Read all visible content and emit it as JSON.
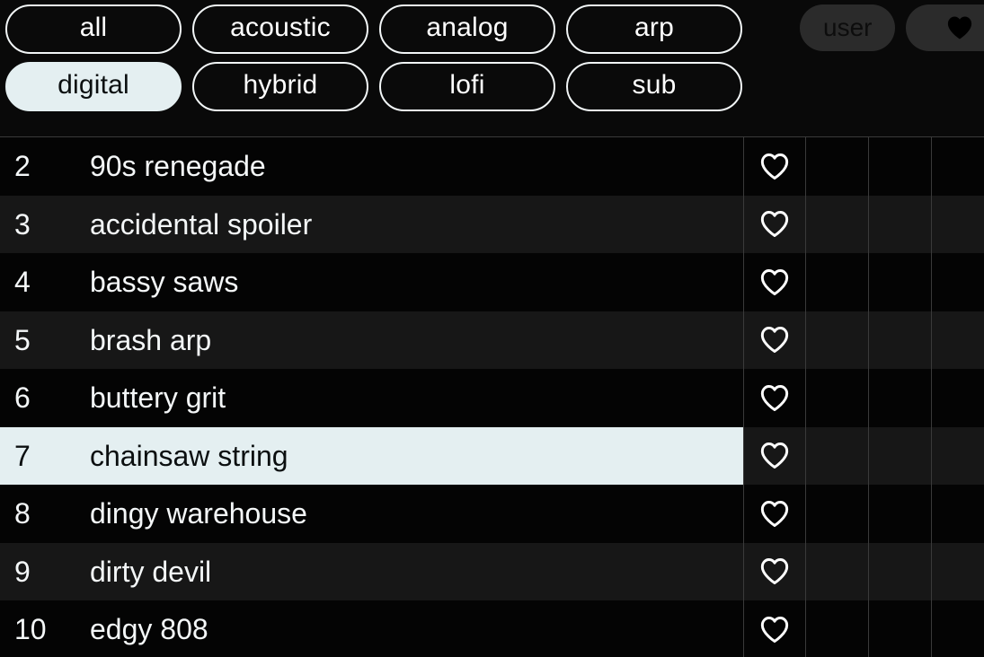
{
  "filters": {
    "chips": [
      {
        "label": "all",
        "selected": false
      },
      {
        "label": "acoustic",
        "selected": false
      },
      {
        "label": "analog",
        "selected": false
      },
      {
        "label": "arp",
        "selected": false
      },
      {
        "label": "digital",
        "selected": true
      },
      {
        "label": "hybrid",
        "selected": false
      },
      {
        "label": "lofi",
        "selected": false
      },
      {
        "label": "sub",
        "selected": false
      }
    ],
    "user_button_label": "user",
    "favorites_button_icon": "heart-filled-icon"
  },
  "colors": {
    "page_background": "#050505",
    "row_background": "#040404",
    "row_background_alt": "#171717",
    "selection": "#e4eff1",
    "chip_border": "#f2f6f7",
    "grid_line": "#3a3a3a",
    "pill_background": "#2b2b2b",
    "text": "#f4f7f8",
    "text_on_selection": "#0b0f10"
  },
  "list": {
    "favorite_icon": "heart-outline-icon",
    "column_divider_x": [
      827,
      896,
      966,
      1036
    ],
    "rows": [
      {
        "index": "2",
        "name": "90s renegade",
        "favorited": false,
        "selected": false
      },
      {
        "index": "3",
        "name": "accidental spoiler",
        "favorited": false,
        "selected": false
      },
      {
        "index": "4",
        "name": "bassy saws",
        "favorited": false,
        "selected": false
      },
      {
        "index": "5",
        "name": "brash arp",
        "favorited": false,
        "selected": false
      },
      {
        "index": "6",
        "name": "buttery grit",
        "favorited": false,
        "selected": false
      },
      {
        "index": "7",
        "name": "chainsaw string",
        "favorited": false,
        "selected": true
      },
      {
        "index": "8",
        "name": "dingy warehouse",
        "favorited": false,
        "selected": false
      },
      {
        "index": "9",
        "name": "dirty devil",
        "favorited": false,
        "selected": false
      },
      {
        "index": "10",
        "name": "edgy 808",
        "favorited": false,
        "selected": false
      }
    ]
  }
}
